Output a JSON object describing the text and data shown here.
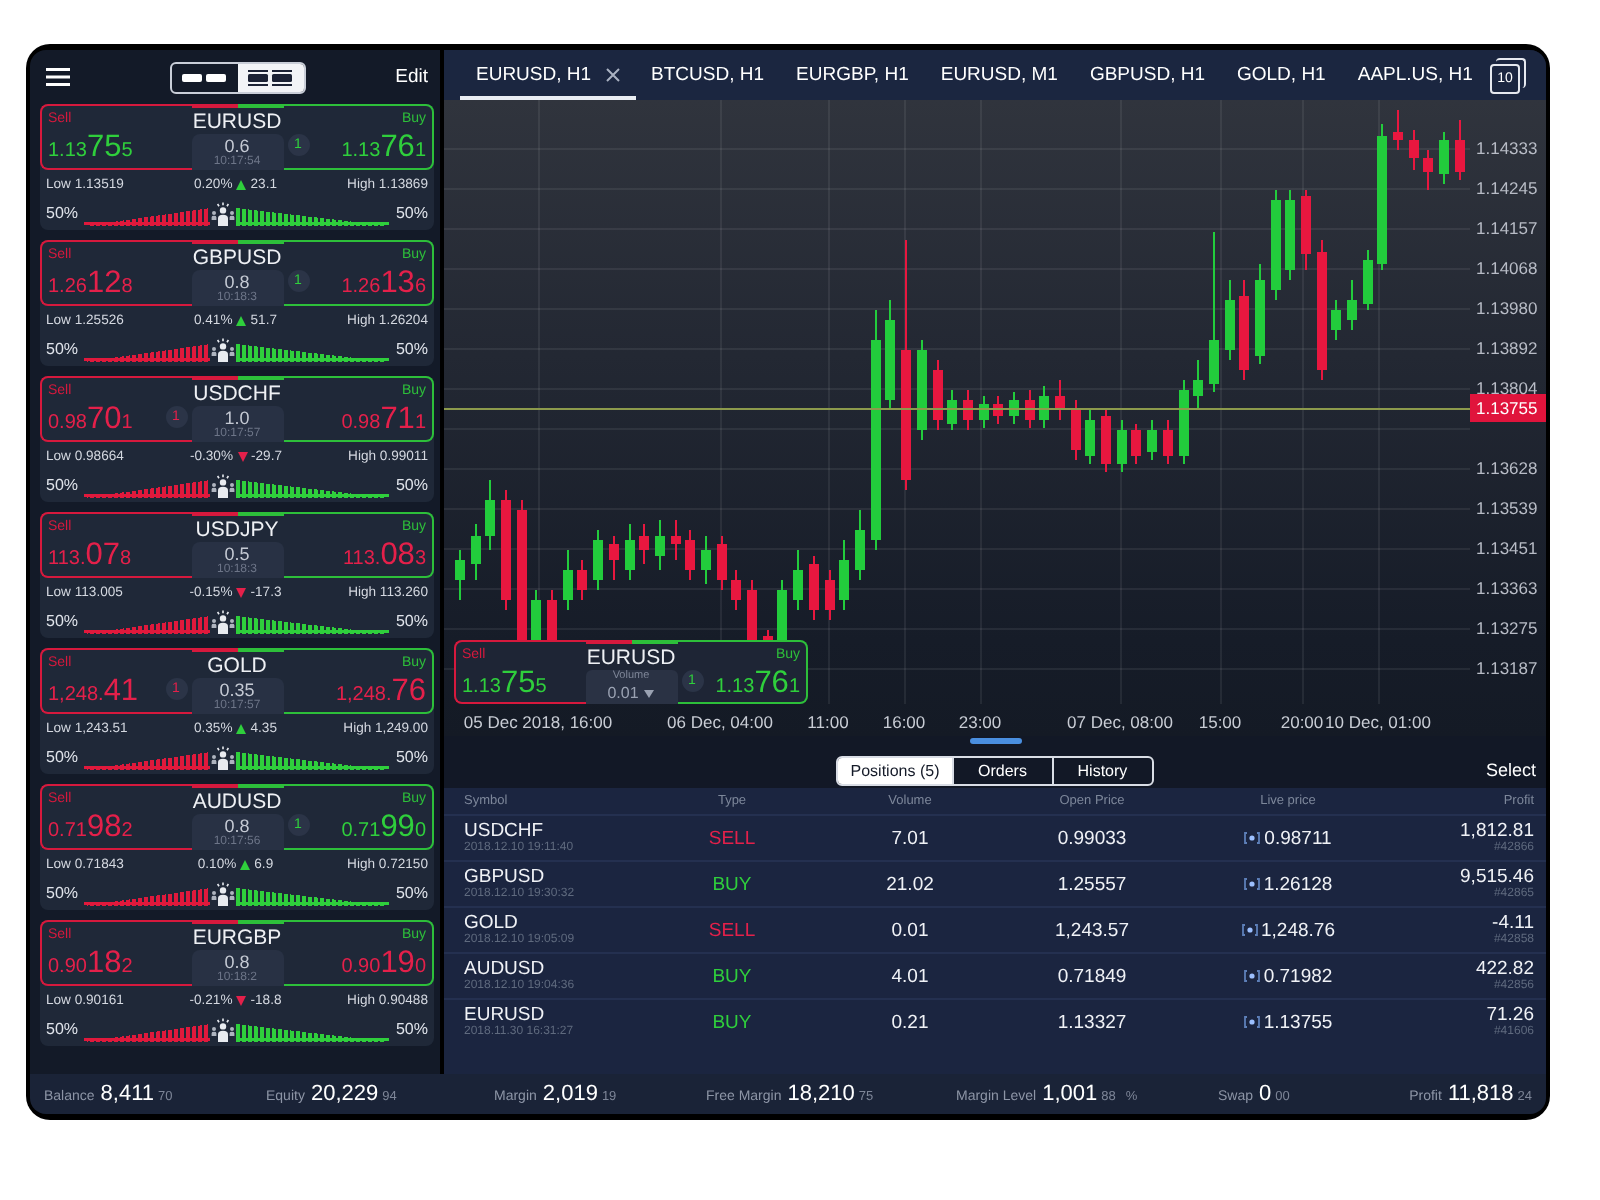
{
  "watchlist_header": {
    "view_toggle": [
      {
        "kind": "compact",
        "selected": false
      },
      {
        "kind": "detailed",
        "selected": true
      }
    ],
    "edit_label": "Edit"
  },
  "watchlist": [
    {
      "symbol": "EURUSD",
      "sell_label": "Sell",
      "sell_price": "1.13**75**5",
      "sell_up": true,
      "buy_label": "Buy",
      "buy_price": "1.13**76**1",
      "buy_up": true,
      "spread": "0.6",
      "time": "10:17:54",
      "badge": {
        "kind": "buy",
        "count": "1"
      },
      "low": "Low 1.13519",
      "change_percent": "0.20%",
      "change_up": true,
      "change_points": "23.1",
      "high": "High 1.13869",
      "sentiment": {
        "sell_label": "50%",
        "level": 0.5,
        "buy_label": "50%"
      }
    },
    {
      "symbol": "GBPUSD",
      "sell_label": "Sell",
      "sell_price": "1.26**12**8",
      "sell_up": false,
      "buy_label": "Buy",
      "buy_price": "1.26**13**6",
      "buy_up": false,
      "spread": "0.8",
      "time": "10:18:3",
      "badge": {
        "kind": "buy",
        "count": "1"
      },
      "low": "Low 1.25526",
      "change_percent": "0.41%",
      "change_up": true,
      "change_points": "51.7",
      "high": "High 1.26204",
      "sentiment": {
        "sell_label": "50%",
        "level": 0.5,
        "buy_label": "50%"
      }
    },
    {
      "symbol": "USDCHF",
      "sell_label": "Sell",
      "sell_price": "0.98**70**1",
      "sell_up": false,
      "buy_label": "Buy",
      "buy_price": "0.98**71**1",
      "buy_up": false,
      "spread": "1.0",
      "time": "10:17:57",
      "badge": {
        "kind": "sell",
        "count": "1"
      },
      "low": "Low 0.98664",
      "change_percent": "-0.30%",
      "change_up": false,
      "change_points": "-29.7",
      "high": "High 0.99011",
      "sentiment": {
        "sell_label": "50%",
        "level": 0.5,
        "buy_label": "50%"
      }
    },
    {
      "symbol": "USDJPY",
      "sell_label": "Sell",
      "sell_price": "113.**07**8",
      "sell_up": false,
      "buy_label": "Buy",
      "buy_price": "113.**08**3",
      "buy_up": false,
      "spread": "0.5",
      "time": "10:18:3",
      "low": "Low 113.005",
      "change_percent": "-0.15%",
      "change_up": false,
      "change_points": "-17.3",
      "high": "High 113.260",
      "sentiment": {
        "sell_label": "50%",
        "level": 0.5,
        "buy_label": "50%"
      }
    },
    {
      "symbol": "GOLD",
      "sell_label": "Sell",
      "sell_price": "1,248.**41**",
      "sell_up": false,
      "buy_label": "Buy",
      "buy_price": "1,248.**76**",
      "buy_up": false,
      "spread": "0.35",
      "time": "10:17:57",
      "badge": {
        "kind": "sell",
        "count": "1"
      },
      "low": "Low 1,243.51",
      "change_percent": "0.35%",
      "change_up": true,
      "change_points": "4.35",
      "high": "High 1,249.00",
      "sentiment": {
        "sell_label": "50%",
        "level": 0.5,
        "buy_label": "50%"
      }
    },
    {
      "symbol": "AUDUSD",
      "sell_label": "Sell",
      "sell_price": "0.71**98**2",
      "sell_up": false,
      "buy_label": "Buy",
      "buy_price": "0.71**99**0",
      "buy_up": true,
      "spread": "0.8",
      "time": "10:17:56",
      "badge": {
        "kind": "buy",
        "count": "1"
      },
      "low": "Low 0.71843",
      "change_percent": "0.10%",
      "change_up": true,
      "change_points": "6.9",
      "high": "High 0.72150",
      "sentiment": {
        "sell_label": "50%",
        "level": 0.5,
        "buy_label": "50%"
      }
    },
    {
      "symbol": "EURGBP",
      "sell_label": "Sell",
      "sell_price": "0.90**18**2",
      "sell_up": false,
      "buy_label": "Buy",
      "buy_price": "0.90**19**0",
      "buy_up": false,
      "spread": "0.8",
      "time": "10:18:2",
      "low": "Low 0.90161",
      "change_percent": "-0.21%",
      "change_up": false,
      "change_points": "-18.8",
      "high": "High 0.90488",
      "sentiment": {
        "sell_label": "50%",
        "level": 0.5,
        "buy_label": "50%"
      }
    }
  ],
  "chart_tabs": [
    {
      "label": "EURUSD, H1",
      "selected": true,
      "closable": true
    },
    {
      "label": "BTCUSD, H1",
      "selected": false,
      "closable": false
    },
    {
      "label": "EURGBP, H1",
      "selected": false,
      "closable": false
    },
    {
      "label": "EURUSD, M1",
      "selected": false,
      "closable": false
    },
    {
      "label": "GBPUSD, H1",
      "selected": false,
      "closable": false
    },
    {
      "label": "GOLD, H1",
      "selected": false,
      "closable": false
    },
    {
      "label": "AAPL.US, H1",
      "selected": false,
      "closable": false
    }
  ],
  "tab_count": "10",
  "chart": {
    "y_labels": [
      "1.14333",
      "1.14245",
      "1.14157",
      "1.14068",
      "1.13980",
      "1.13892",
      "1.13804",
      "1.13628",
      "1.13539",
      "1.13451",
      "1.13363",
      "1.13275",
      "1.13187"
    ],
    "current_price": "1.13755",
    "x_labels": [
      "05 Dec 2018, 16:00",
      "06 Dec, 04:00",
      "11:00",
      "16:00",
      "23:00",
      "07 Dec, 08:00",
      "15:00",
      "20:00",
      "10 Dec, 01:00"
    ],
    "quick_trade": {
      "symbol": "EURUSD",
      "sell_label": "Sell",
      "sell_price": "1.13**75**5",
      "sell_up": true,
      "buy_label": "Buy",
      "buy_price": "1.13**76**1",
      "buy_up": true,
      "volume_label": "Volume",
      "volume": "0.01",
      "badge": {
        "kind": "buy",
        "count": "1"
      }
    }
  },
  "positions": {
    "tabs": [
      {
        "label": "Positions (5)",
        "selected": true
      },
      {
        "label": "Orders",
        "selected": false
      },
      {
        "label": "History",
        "selected": false
      }
    ],
    "select_label": "Select",
    "columns": [
      "Symbol",
      "Type",
      "Volume",
      "Open Price",
      "Live price",
      "Profit"
    ],
    "rows": [
      {
        "symbol": "USDCHF",
        "opened": "2018.12.10 19:11:40",
        "type": "SELL",
        "kind": "sell",
        "volume": "7.01",
        "open_price": "0.99033",
        "live_price": "0.98711",
        "profit": "1,812.81",
        "ticket": "#42866"
      },
      {
        "symbol": "GBPUSD",
        "opened": "2018.12.10 19:30:32",
        "type": "BUY",
        "kind": "buy",
        "volume": "21.02",
        "open_price": "1.25557",
        "live_price": "1.26128",
        "profit": "9,515.46",
        "ticket": "#42865"
      },
      {
        "symbol": "GOLD",
        "opened": "2018.12.10 19:05:09",
        "type": "SELL",
        "kind": "sell",
        "volume": "0.01",
        "open_price": "1,243.57",
        "live_price": "1,248.76",
        "profit": "-4.11",
        "ticket": "#42858"
      },
      {
        "symbol": "AUDUSD",
        "opened": "2018.12.10 19:04:36",
        "type": "BUY",
        "kind": "buy",
        "volume": "4.01",
        "open_price": "0.71849",
        "live_price": "0.71982",
        "profit": "422.82",
        "ticket": "#42856"
      },
      {
        "symbol": "EURUSD",
        "opened": "2018.11.30 16:31:27",
        "type": "BUY",
        "kind": "buy",
        "volume": "0.21",
        "open_price": "1.13327",
        "live_price": "1.13755",
        "profit": "71.26",
        "ticket": "#41606"
      }
    ]
  },
  "account_summary": [
    {
      "label": "Balance",
      "value": "8,411",
      "decimals": "70"
    },
    {
      "label": "Equity",
      "value": "20,229",
      "decimals": "94"
    },
    {
      "label": "Margin",
      "value": "2,019",
      "decimals": "19"
    },
    {
      "label": "Free Margin",
      "value": "18,210",
      "decimals": "75"
    },
    {
      "label": "Margin Level",
      "value": "1,001",
      "decimals": "88",
      "unit": "%"
    },
    {
      "label": "Swap",
      "value": "0",
      "decimals": "00"
    },
    {
      "label": "Profit",
      "value": "11,818",
      "decimals": "24"
    }
  ]
}
